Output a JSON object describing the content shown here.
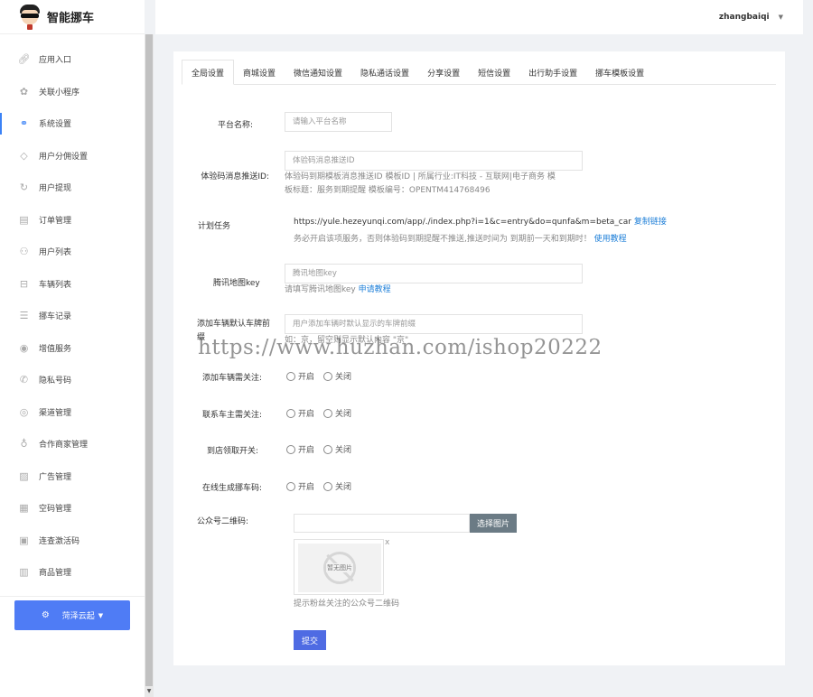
{
  "app": {
    "title": "智能挪车"
  },
  "header": {
    "username": "zhangbaiqi"
  },
  "sidebar": {
    "items": [
      {
        "label": "应用入口",
        "icon": "link-icon"
      },
      {
        "label": "关联小程序",
        "icon": "miniprogram-icon"
      },
      {
        "label": "系统设置",
        "icon": "settings-link-icon",
        "active": true
      },
      {
        "label": "用户分佣设置",
        "icon": "diamond-icon"
      },
      {
        "label": "用户提现",
        "icon": "refresh-icon"
      },
      {
        "label": "订单管理",
        "icon": "order-icon"
      },
      {
        "label": "用户列表",
        "icon": "user-icon"
      },
      {
        "label": "车辆列表",
        "icon": "car-icon"
      },
      {
        "label": "挪车记录",
        "icon": "record-icon"
      },
      {
        "label": "增值服务",
        "icon": "camera-icon"
      },
      {
        "label": "隐私号码",
        "icon": "phone-icon"
      },
      {
        "label": "渠道管理",
        "icon": "channel-icon"
      },
      {
        "label": "合作商家管理",
        "icon": "merchant-icon"
      },
      {
        "label": "广告管理",
        "icon": "image-icon"
      },
      {
        "label": "空码管理",
        "icon": "qrcode-icon"
      },
      {
        "label": "连查激活码",
        "icon": "calendar-icon"
      },
      {
        "label": "商品管理",
        "icon": "goods-icon"
      }
    ],
    "brand_button": "菏泽云起"
  },
  "tabs": [
    "全局设置",
    "商城设置",
    "微信通知设置",
    "隐私通话设置",
    "分享设置",
    "短信设置",
    "出行助手设置",
    "挪车模板设置"
  ],
  "form": {
    "platform_name": {
      "label": "平台名称:",
      "placeholder": "请输入平台名称"
    },
    "exp_template": {
      "label": "体验码消息推送ID:",
      "placeholder": "体验码消息推送ID",
      "help_line1": "体验码到期模板消息推送ID 模板ID | 所属行业:IT科技 - 互联网|电子商务 模",
      "help_line2": "板标题：服务到期提醒 模板编号：OPENTM414768496"
    },
    "cron": {
      "label": "计划任务",
      "url": "https://yule.hezeyunqi.com/app/./index.php?i=1&c=entry&do=qunfa&m=beta_car",
      "copy_link": "复制链接",
      "help": "务必开启该项服务，否则体验码到期提醒不推送,推送时间为 到期前一天和到期时！",
      "tutorial_link": "使用教程"
    },
    "tencent_map": {
      "label": "腾讯地图key",
      "placeholder": "腾讯地图key",
      "help": "请填写腾讯地图key",
      "apply_link": "申请教程"
    },
    "plate_prefix": {
      "label": "添加车辆默认车牌前缀",
      "placeholder": "用户添加车辆时默认显示的车牌前缀",
      "help": "如：京，留空则显示默认内容 \"京\""
    },
    "radios": [
      {
        "label": "添加车辆需关注:",
        "on": "开启",
        "off": "关闭"
      },
      {
        "label": "联系车主需关注:",
        "on": "开启",
        "off": "关闭"
      },
      {
        "label": "到店领取开关:",
        "on": "开启",
        "off": "关闭"
      },
      {
        "label": "在线生成挪车码:",
        "on": "开启",
        "off": "关闭"
      }
    ],
    "qrcode": {
      "label": "公众号二维码:",
      "select_button": "选择图片",
      "no_image": "暂无图片",
      "close": "x",
      "help": "提示粉丝关注的公众号二维码"
    },
    "submit": "提交"
  },
  "watermark": "https://www.huzhan.com/ishop20222"
}
